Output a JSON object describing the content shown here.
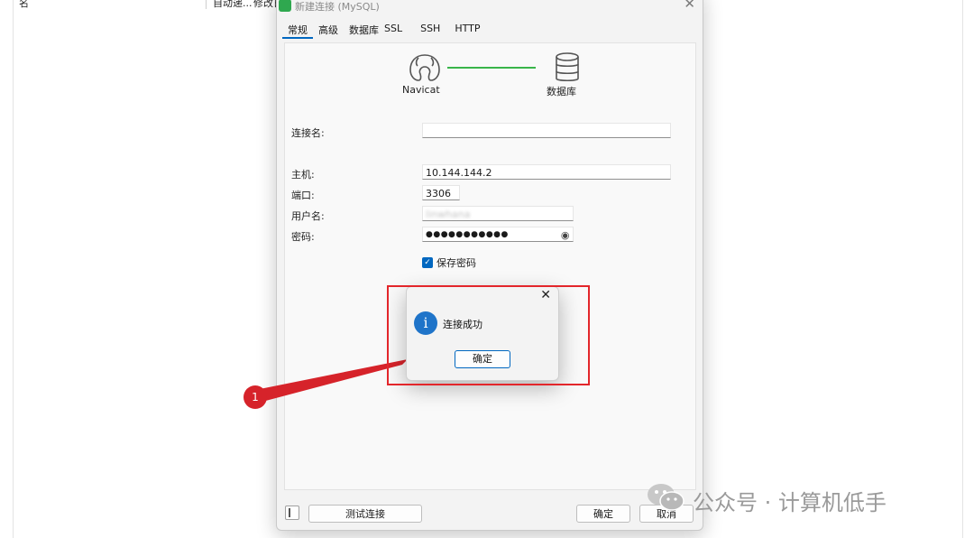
{
  "background": {
    "columns": [
      "名",
      "自动递...",
      "修改日"
    ]
  },
  "dialog": {
    "title": "新建连接 (MySQL)",
    "tabs": [
      "常规",
      "高级",
      "数据库",
      "SSL",
      "SSH",
      "HTTP"
    ],
    "icons": {
      "navicat_label": "Navicat",
      "database_label": "数据库"
    },
    "form": {
      "connection_name_label": "连接名:",
      "connection_name_value": "",
      "host_label": "主机:",
      "host_value": "10.144.144.2",
      "port_label": "端口:",
      "port_value": "3306",
      "username_label": "用户名:",
      "username_value": "linwhana",
      "password_label": "密码:",
      "password_value": "●●●●●●●●●●●",
      "save_password_label": "保存密码",
      "save_password_checked": true
    },
    "footer": {
      "test_connection": "测试连接",
      "ok": "确定",
      "cancel": "取消"
    }
  },
  "message_box": {
    "text": "连接成功",
    "ok": "确定"
  },
  "annotation": {
    "number": "1",
    "color": "#e3262b"
  },
  "watermark": {
    "text": "公众号 · 计算机低手"
  }
}
